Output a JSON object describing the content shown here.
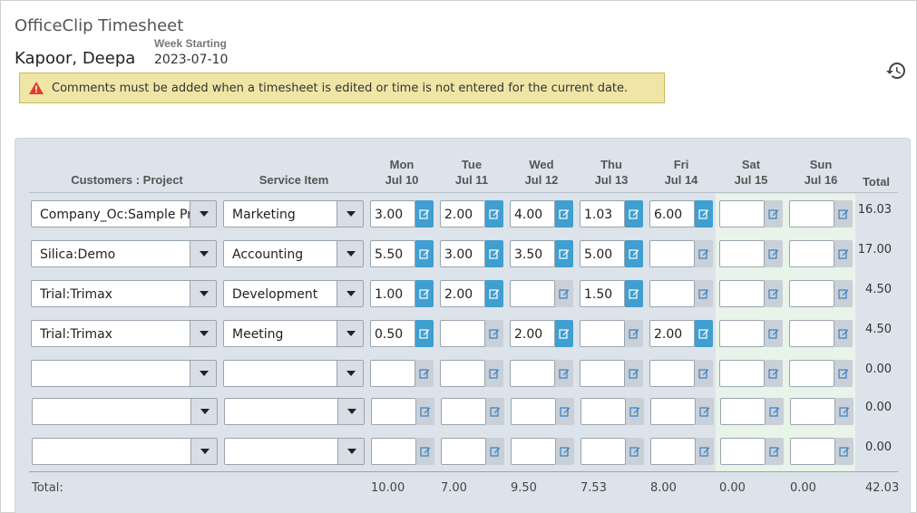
{
  "app_title": "OfficeClip Timesheet",
  "employee_name": "Kapoor, Deepa",
  "week": {
    "label": "Week Starting",
    "date": "2023-07-10"
  },
  "alert": {
    "message": "Comments must be added when a timesheet is edited or time is not entered for the current date.",
    "color": "#efe6a6"
  },
  "headers": {
    "project": "Customers : Project",
    "service": "Service Item",
    "total": "Total",
    "days": [
      {
        "day": "Mon",
        "date": "Jul 10"
      },
      {
        "day": "Tue",
        "date": "Jul 11"
      },
      {
        "day": "Wed",
        "date": "Jul 12"
      },
      {
        "day": "Thu",
        "date": "Jul 13"
      },
      {
        "day": "Fri",
        "date": "Jul 14"
      },
      {
        "day": "Sat",
        "date": "Jul 15"
      },
      {
        "day": "Sun",
        "date": "Jul 16"
      }
    ]
  },
  "rows": [
    {
      "project": "Company_Oc:Sample Pr...",
      "service": "Marketing",
      "hours": [
        "3.00",
        "2.00",
        "4.00",
        "1.03",
        "6.00",
        "",
        ""
      ],
      "total": "16.03"
    },
    {
      "project": "Silica:Demo",
      "service": "Accounting",
      "hours": [
        "5.50",
        "3.00",
        "3.50",
        "5.00",
        "",
        "",
        ""
      ],
      "total": "17.00"
    },
    {
      "project": "Trial:Trimax",
      "service": "Development",
      "hours": [
        "1.00",
        "2.00",
        "",
        "1.50",
        "",
        "",
        ""
      ],
      "total": "4.50"
    },
    {
      "project": "Trial:Trimax",
      "service": "Meeting",
      "hours": [
        "0.50",
        "",
        "2.00",
        "",
        "2.00",
        "",
        ""
      ],
      "total": "4.50"
    },
    {
      "project": "",
      "service": "",
      "hours": [
        "",
        "",
        "",
        "",
        "",
        "",
        ""
      ],
      "total": "0.00"
    },
    {
      "project": "",
      "service": "",
      "hours": [
        "",
        "",
        "",
        "",
        "",
        "",
        ""
      ],
      "total": "0.00"
    },
    {
      "project": "",
      "service": "",
      "hours": [
        "",
        "",
        "",
        "",
        "",
        "",
        ""
      ],
      "total": "0.00"
    }
  ],
  "totals": {
    "label": "Total:",
    "days": [
      "10.00",
      "7.00",
      "9.50",
      "7.53",
      "8.00",
      "0.00",
      "0.00"
    ],
    "grand": "42.03"
  },
  "colors": {
    "panel": "#dde3ea",
    "active_comment": "#3f9fd0",
    "inactive_comment": "#c9d0d7",
    "weekend": "#e8f3ea"
  },
  "icons": {
    "history": "history-icon",
    "alert": "warning-icon",
    "comment": "edit-icon",
    "dropdown": "dropdown-arrow-icon"
  }
}
